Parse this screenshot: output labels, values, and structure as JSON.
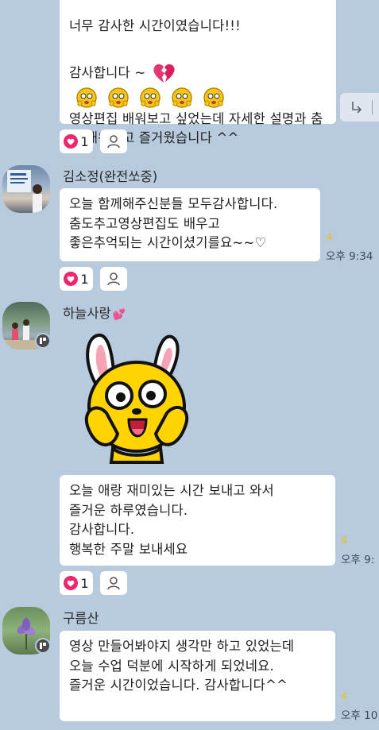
{
  "messages": [
    {
      "sender": "",
      "text_top": "너무 감사한 시간이였습니다!!!",
      "line_thanks": "감사합니다 ~",
      "text_body": "영상편집 배워보고 싶었는데 자세한 설명과 춤도 배워보고 즐거웠습니다 ^^",
      "reaction_count": "1"
    },
    {
      "sender": "김소정(완전쏘중)",
      "text": "오늘 함께해주신분들 모두감사합니다.\n춤도추고영상편집도 배우고\n좋은추억되는 시간이셨기를요~~♡",
      "read_count": "4",
      "time": "오후 9:34",
      "reaction_count": "1"
    },
    {
      "sender": "하늘사랑",
      "sender_suffix": "💕",
      "text": "오늘 애랑 재미있는 시간 보내고 와서\n즐거운 하루였습니다.\n감사합니다.\n행복한 주말 보내세요",
      "read_count": "4",
      "time": "오후 9:",
      "reaction_count": "1"
    },
    {
      "sender": "구름산",
      "text": "영상 만들어봐야지 생각만 하고 있었는데\n오늘 수업 덕분에 시작하게 되었네요.\n즐거운 시간이었습니다. 감사합니다^^",
      "read_count": "4",
      "time": "오후 10"
    }
  ],
  "colors": {
    "background": "#b8cadd",
    "heart": "#f0266b",
    "unread": "#e6c315"
  },
  "icons": [
    "share-icon",
    "heart-icon",
    "user-icon",
    "broken-heart-icon",
    "sticker-face-icon",
    "bunny-sticker"
  ]
}
